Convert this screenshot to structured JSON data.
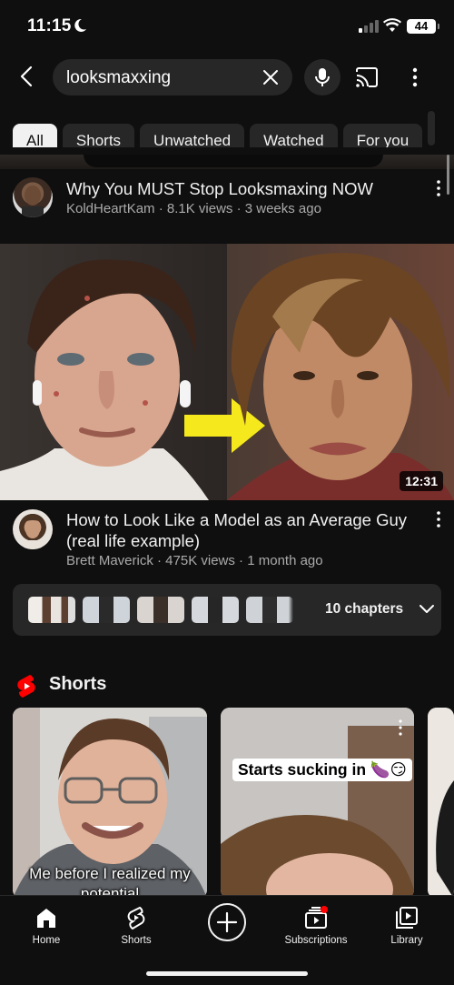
{
  "status_bar": {
    "time": "11:15",
    "battery": "44"
  },
  "search": {
    "query": "looksmaxxing"
  },
  "chips": [
    "All",
    "Shorts",
    "Unwatched",
    "Watched",
    "For you"
  ],
  "videos": [
    {
      "title": "Why You MUST Stop Looksmaxing NOW",
      "meta": "KoldHeartKam · 8.1K views · 3 weeks ago"
    },
    {
      "title": "How to Look Like a Model as an Average Guy (real life example)",
      "meta": "Brett Maverick · 475K views · 1 month ago",
      "duration": "12:31"
    }
  ],
  "chapters": {
    "label": "10 chapters"
  },
  "shorts": {
    "heading": "Shorts",
    "items": [
      {
        "caption": "Me before I realized my potential"
      },
      {
        "overlay": "Starts sucking in 🍆😏"
      }
    ]
  },
  "nav": {
    "home": "Home",
    "shorts": "Shorts",
    "subscriptions": "Subscriptions",
    "library": "Library"
  },
  "colors": {
    "background": "#0f0f0f",
    "chip": "#272727",
    "shorts_red": "#ff0000",
    "arrow_yellow": "#f5e81c"
  }
}
